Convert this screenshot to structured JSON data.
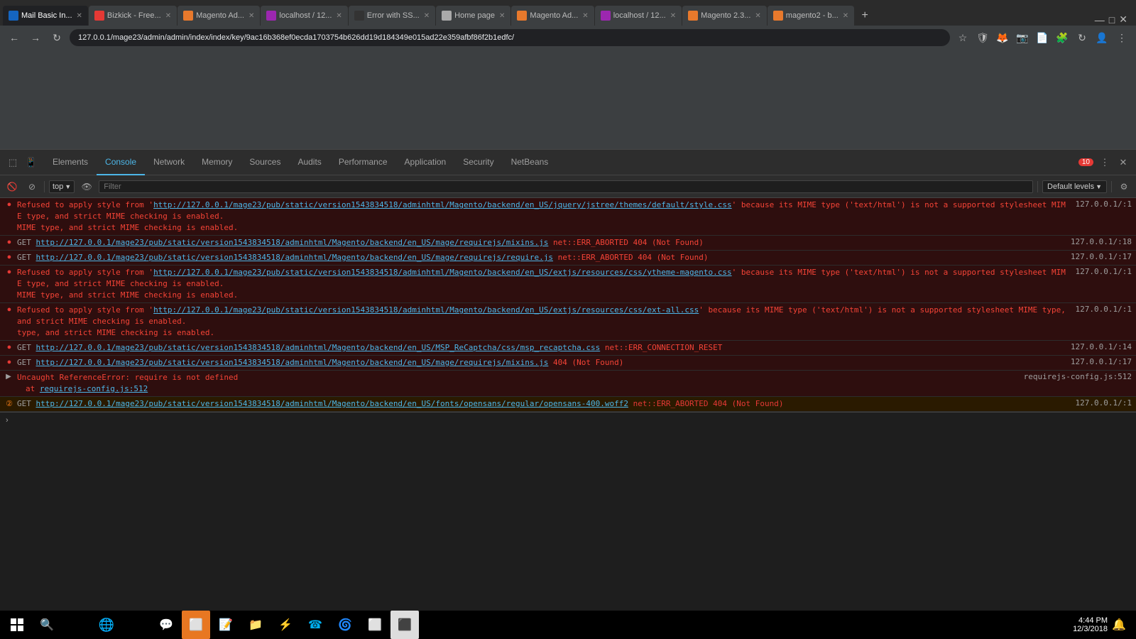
{
  "browser": {
    "tabs": [
      {
        "id": "tab-mail",
        "label": "Mail Basic In...",
        "favicon_class": "fav-mail",
        "active": true
      },
      {
        "id": "tab-bizkick",
        "label": "Bizkick - Free...",
        "favicon_class": "fav-bizkick",
        "active": false
      },
      {
        "id": "tab-magento-ad",
        "label": "Magento Ad...",
        "favicon_class": "fav-magento",
        "active": false
      },
      {
        "id": "tab-localhost1",
        "label": "localhost / 12...",
        "favicon_class": "fav-localhost",
        "active": false
      },
      {
        "id": "tab-github",
        "label": "Error with SS...",
        "favicon_class": "fav-github",
        "active": false
      },
      {
        "id": "tab-home",
        "label": "Home page",
        "favicon_class": "fav-home",
        "active": false
      },
      {
        "id": "tab-magento-ad2",
        "label": "Magento Ad...",
        "favicon_class": "fav-magento",
        "active": false
      },
      {
        "id": "tab-localhost2",
        "label": "localhost / 12...",
        "favicon_class": "fav-localhost",
        "active": false
      },
      {
        "id": "tab-magento23",
        "label": "Magento 2.3...",
        "favicon_class": "fav-magento",
        "active": false
      },
      {
        "id": "tab-magento2b",
        "label": "magento2 - b...",
        "favicon_class": "fav-magento",
        "active": false
      }
    ],
    "url": "127.0.0.1/mage23/admin/admin/index/index/key/9ac16b368ef0ecda1703754b626dd19d184349e015ad22e359afbf86f2b1edfc/",
    "window_controls": {
      "minimize": "—",
      "maximize": "□",
      "close": "✕"
    }
  },
  "devtools": {
    "tabs": [
      {
        "label": "Elements",
        "active": false
      },
      {
        "label": "Console",
        "active": true
      },
      {
        "label": "Network",
        "active": false
      },
      {
        "label": "Memory",
        "active": false
      },
      {
        "label": "Sources",
        "active": false
      },
      {
        "label": "Audits",
        "active": false
      },
      {
        "label": "Performance",
        "active": false
      },
      {
        "label": "Application",
        "active": false
      },
      {
        "label": "Security",
        "active": false
      },
      {
        "label": "NetBeans",
        "active": false
      }
    ],
    "error_count": "10",
    "console": {
      "context": "top",
      "filter_placeholder": "Filter",
      "levels": "Default levels",
      "entries": [
        {
          "type": "error",
          "icon": "●",
          "text": "Refused to apply style from 'http://127.0.0.1/mage23/pub/static/version1543834518/adminhtml/Magento/backend/en_US/jquery/jstree/themes/default/style.css' because its MIME type ('text/html') is not a supported stylesheet MIME type, and strict MIME checking is enabled.",
          "source": "127.0.0.1/:1",
          "link": "http://127.0.0.1/mage23/pub/static/version1543834518/adminhtml/Magento/backend/en_US/jquery/jstree/themes/default/style.css"
        },
        {
          "type": "error",
          "icon": "●",
          "text_prefix": "GET ",
          "link": "http://127.0.0.1/mage23/pub/static/version1543834518/adminhtml/Magento/backend/en_US/mage/requirejs/mixins.js",
          "text_suffix": " net::ERR_ABORTED 404 (Not Found)",
          "source": "127.0.0.1/:18"
        },
        {
          "type": "error",
          "icon": "●",
          "text_prefix": "GET ",
          "link": "http://127.0.0.1/mage23/pub/static/version1543834518/adminhtml/Magento/backend/en_US/mage/requirejs/require.js",
          "text_suffix": " net::ERR_ABORTED 404 (Not Found)",
          "source": "127.0.0.1/:17"
        },
        {
          "type": "error",
          "icon": "●",
          "text": "Refused to apply style from 'http://127.0.0.1/mage23/pub/static/version1543834518/adminhtml/Magento/backend/en_US/extjs/resources/css/ytheme-magento.css' because its MIME type ('text/html') is not a supported stylesheet MIME type, and strict MIME checking is enabled.",
          "source": "127.0.0.1/:1",
          "link": "http://127.0.0.1/mage23/pub/static/version1543834518/adminhtml/Magento/backend/en_US/extjs/resources/css/ytheme-magento.css",
          "continuation": "MIME type, and strict MIME checking is enabled."
        },
        {
          "type": "error",
          "icon": "●",
          "text": "Refused to apply style from 'http://127.0.0.1/mage23/pub/static/version1543834518/adminhtml/Magento/backend/en_US/extjs/resources/css/ext-all.css' because its MIME type ('text/html') is not a supported stylesheet MIME type, and strict MIME checking is enabled.",
          "source": "127.0.0.1/:1",
          "link": "http://127.0.0.1/mage23/pub/static/version1543834518/adminhtml/Magento/backend/en_US/extjs/resources/css/ext-all.css",
          "continuation": "type, and strict MIME checking is enabled."
        },
        {
          "type": "error",
          "icon": "●",
          "text_prefix": "GET ",
          "link": "http://127.0.0.1/mage23/pub/static/version1543834518/adminhtml/Magento/backend/en_US/MSP_ReCaptcha/css/msp_recaptcha.css",
          "text_suffix": " net::ERR_CONNECTION_RESET",
          "source": "127.0.0.1/:14"
        },
        {
          "type": "error",
          "icon": "●",
          "text_prefix": "GET ",
          "link": "http://127.0.0.1/mage23/pub/static/version1543834518/adminhtml/Magento/backend/en_US/mage/requirejs/mixins.js",
          "text_suffix": " 404 (Not Found)",
          "source": "127.0.0.1/:17"
        },
        {
          "type": "error",
          "icon": "●",
          "expandable": true,
          "text": "Uncaught ReferenceError: require is not defined",
          "continuation": "    at requirejs-config.js:512",
          "continuation_link": "requirejs-config.js:512",
          "source": "requirejs-config.js:512"
        },
        {
          "type": "error2",
          "icon": "②",
          "text_prefix": "GET ",
          "link": "http://127.0.0.1/mage23/pub/static/version1543834518/adminhtml/Magento/backend/en_US/fonts/opensans/regular/opensans-400.woff2",
          "text_suffix": " net::ERR_ABORTED 404 (Not Found)",
          "source": "127.0.0.1/:1"
        }
      ]
    }
  },
  "taskbar": {
    "time": "4:44 PM",
    "date": "12/3/2018",
    "icons": [
      "⊞",
      "⌕",
      "⛃",
      "🌐",
      "🛡",
      "⊙",
      "📁",
      "⚡",
      "📋",
      "☎",
      "🌀",
      "⊡",
      "🖥"
    ]
  }
}
